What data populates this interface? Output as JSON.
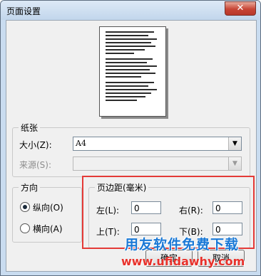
{
  "window": {
    "title": "页面设置",
    "close_glyph": "✕"
  },
  "paper": {
    "group_label": "纸张",
    "size_label": "大小(Z):",
    "size_value": "A4",
    "source_label": "来源(S):",
    "source_value": ""
  },
  "orientation": {
    "group_label": "方向",
    "portrait_label": "纵向(O)",
    "landscape_label": "横向(A)",
    "selected": "portrait"
  },
  "margins": {
    "group_label": "页边距(毫米)",
    "left_label": "左(L):",
    "left_value": "0",
    "right_label": "右(R):",
    "right_value": "0",
    "top_label": "上(T):",
    "top_value": "0",
    "bottom_label": "下(B):",
    "bottom_value": "0"
  },
  "buttons": {
    "ok_label": "确定",
    "cancel_label": "取消"
  },
  "watermark": {
    "line1": "用友软件免费下载",
    "line2": "www.ufidawhy.com"
  },
  "colors": {
    "highlight_box": "#e43a37",
    "watermark_blue": "#1a79d6",
    "watermark_red": "#e8312b"
  }
}
